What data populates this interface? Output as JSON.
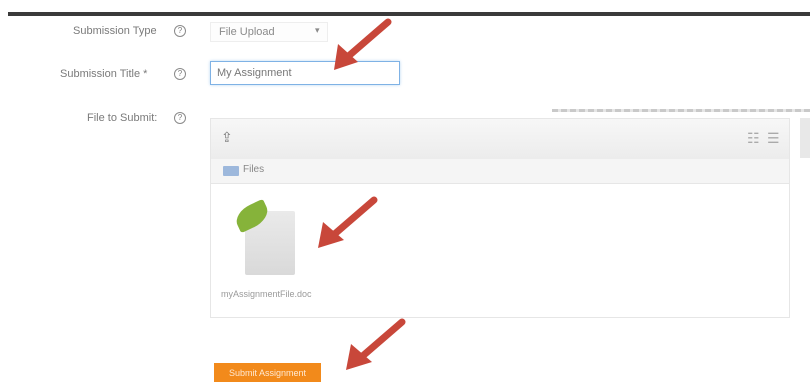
{
  "form": {
    "submission_type": {
      "label": "Submission Type",
      "help": "?",
      "value": "File Upload",
      "caret": "▾"
    },
    "submission_title": {
      "label": "Submission Title *",
      "help": "?",
      "value": "My Assignment"
    },
    "file_to_submit": {
      "label": "File to Submit:",
      "help": "?"
    },
    "file_browser": {
      "upload_icon_glyph": "⇪",
      "view_glyphs": [
        "☷",
        "☰"
      ],
      "path_label": "Files",
      "files": [
        {
          "name": "myAssignmentFile.doc",
          "icon": "document-icon"
        }
      ]
    },
    "submit_button_label": "Submit Assignment"
  },
  "colors": {
    "accent_orange": "#f28a1b",
    "annotation_arrow": "#c8473a",
    "input_focus_border": "#7fb2e5"
  }
}
